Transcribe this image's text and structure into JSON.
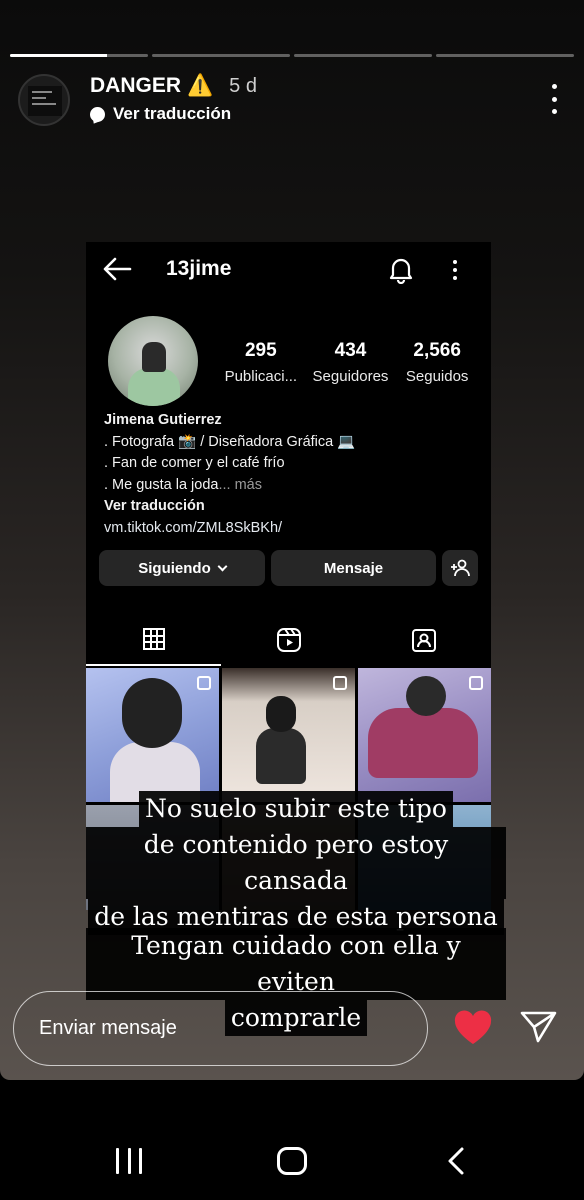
{
  "story": {
    "progress": [
      0.7,
      0,
      0,
      0
    ],
    "username": "DANGER",
    "warning_emoji": "⚠️",
    "time": "5 d",
    "translate_label": "Ver traducción"
  },
  "profile": {
    "handle": "13jime",
    "stats": [
      {
        "value": "295",
        "label": "Publicaci..."
      },
      {
        "value": "434",
        "label": "Seguidores"
      },
      {
        "value": "2,566",
        "label": "Seguidos"
      }
    ],
    "name": "Jimena Gutierrez",
    "bio_line1": ". Fotografa 📸 / Diseñadora Gráfica 💻",
    "bio_line2": ". Fan de comer y el café frío",
    "bio_line3": ". Me gusta la joda",
    "bio_more": "... más",
    "bio_translate": "Ver traducción",
    "link": "vm.tiktok.com/ZML8SkBKh/",
    "following_label": "Siguiendo",
    "message_label": "Mensaje"
  },
  "captions": {
    "line1": "No suelo subir este tipo",
    "line2": "de contenido pero estoy cansada",
    "line3": "de las mentiras de esta persona",
    "line4": "Tengan cuidado con ella y eviten",
    "line5": "comprarle"
  },
  "reply": {
    "placeholder": "Enviar mensaje"
  },
  "icons": {
    "heart_color": "#ed2f45",
    "heart": "heart-icon",
    "send": "send-icon"
  }
}
